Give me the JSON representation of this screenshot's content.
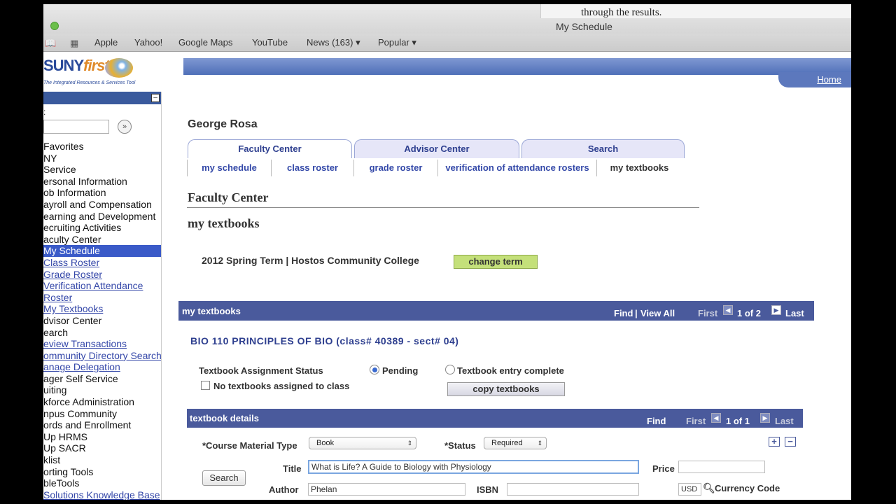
{
  "browser": {
    "window_title": "My Schedule",
    "bubble_text": "through the results.",
    "bookmarks": [
      "Apple",
      "Yahoo!",
      "Google Maps",
      "YouTube",
      "News (163) ▾",
      "Popular ▾"
    ]
  },
  "header": {
    "logo_main": "SUNY",
    "logo_first": "first",
    "logo_sub": "The Integrated Resources & Services Tool",
    "home_link": "Home"
  },
  "leftmenu": {
    "colon": ":",
    "go_glyph": "»",
    "items": [
      {
        "label": "Favorites",
        "type": "text"
      },
      {
        "label": "NY",
        "type": "text"
      },
      {
        "label": "Service",
        "type": "text"
      },
      {
        "label": "ersonal Information",
        "type": "text"
      },
      {
        "label": "ob Information",
        "type": "text"
      },
      {
        "label": "ayroll and Compensation",
        "type": "text"
      },
      {
        "label": "earning and Development",
        "type": "text"
      },
      {
        "label": "ecruiting Activities",
        "type": "text"
      },
      {
        "label": "aculty Center",
        "type": "text"
      },
      {
        "label": "My Schedule",
        "type": "selected"
      },
      {
        "label": "Class Roster",
        "type": "link"
      },
      {
        "label": "Grade Roster",
        "type": "link"
      },
      {
        "label": "Verification Attendance",
        "type": "link"
      },
      {
        "label": "Roster",
        "type": "link"
      },
      {
        "label": "My Textbooks",
        "type": "link"
      },
      {
        "label": "dvisor Center",
        "type": "text"
      },
      {
        "label": "earch",
        "type": "text"
      },
      {
        "label": "eview Transactions",
        "type": "link"
      },
      {
        "label": "ommunity Directory Search",
        "type": "link"
      },
      {
        "label": "anage Delegation",
        "type": "link"
      },
      {
        "label": "ager Self Service",
        "type": "text"
      },
      {
        "label": "uiting",
        "type": "text"
      },
      {
        "label": "kforce Administration",
        "type": "text"
      },
      {
        "label": "npus Community",
        "type": "text"
      },
      {
        "label": "ords and Enrollment",
        "type": "text"
      },
      {
        "label": "Up HRMS",
        "type": "text"
      },
      {
        "label": "Up SACR",
        "type": "text"
      },
      {
        "label": "klist",
        "type": "text"
      },
      {
        "label": "orting Tools",
        "type": "text"
      },
      {
        "label": "bleTools",
        "type": "text"
      },
      {
        "label": "Solutions Knowledge Base",
        "type": "link"
      }
    ]
  },
  "main": {
    "person_name": "George Rosa",
    "tabs": [
      "Faculty Center",
      "Advisor Center",
      "Search"
    ],
    "subtabs": [
      "my schedule",
      "class roster",
      "grade roster",
      "verification of attendance rosters",
      "my textbooks"
    ],
    "page_title": "Faculty Center",
    "section_title": "my textbooks",
    "term_text": "2012 Spring Term | Hostos Community College",
    "change_term": "change term",
    "panel": {
      "title": "my textbooks",
      "find": "Find",
      "sep": "|",
      "view_all": "View All",
      "first": "First",
      "count": "1 of 2",
      "last": "Last"
    },
    "course": "BIO  110  PRINCIPLES OF BIO (class# 40389 - sect# 04)",
    "assignment_status_label": "Textbook Assignment Status",
    "status_pending": "Pending",
    "status_complete": "Textbook entry complete",
    "no_textbooks": "No textbooks assigned to class",
    "copy_textbooks": "copy textbooks",
    "details_panel": {
      "title": "textbook details",
      "find": "Find",
      "first": "First",
      "count": "1 of 1",
      "last": "Last"
    },
    "form": {
      "material_type_label": "*Course Material Type",
      "material_type_value": "Book",
      "status_label": "*Status",
      "status_value": "Required",
      "search_button": "Search",
      "title_label": "Title",
      "title_value": "What is Life? A Guide to Biology with Physiology",
      "price_label": "Price",
      "price_value": "",
      "author_label": "Author",
      "author_value": "Phelan",
      "isbn_label": "ISBN",
      "isbn_value": "",
      "currency_value": "USD",
      "currency_label": "Currency Code"
    }
  }
}
